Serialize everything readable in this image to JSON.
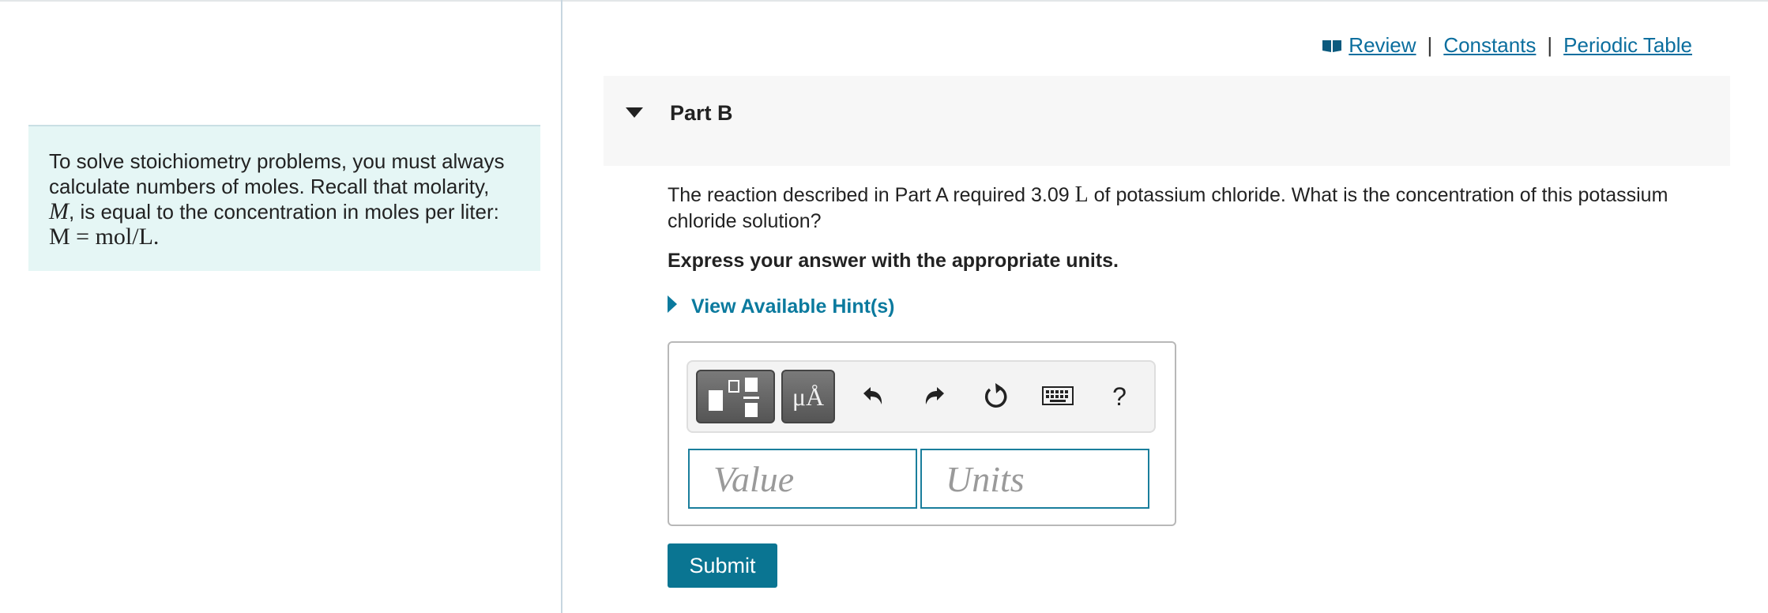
{
  "links": {
    "review": "Review",
    "constants": "Constants",
    "periodic_table": "Periodic Table",
    "separator": "|"
  },
  "info": {
    "line1": "To solve stoichiometry problems, you must always calculate numbers of moles. Recall that molarity,",
    "molarity_symbol": "M",
    "line2": ", is equal to the concentration in moles per liter:",
    "equation": "M = mol/L."
  },
  "part": {
    "title": "Part B"
  },
  "question": {
    "text_before": "The reaction described in Part A required 3.09 ",
    "unit": "L",
    "text_after": " of potassium chloride. What is the concentration of this potassium chloride solution?",
    "instruction": "Express your answer with the appropriate units."
  },
  "hint": {
    "label": "View Available Hint(s)"
  },
  "toolbar": {
    "units_symbol": "μÅ",
    "help": "?",
    "icons": [
      "templates-icon",
      "units-icon",
      "undo-icon",
      "redo-icon",
      "reset-icon",
      "keyboard-icon",
      "help-icon"
    ]
  },
  "answer": {
    "value": "",
    "value_placeholder": "Value",
    "units": "",
    "units_placeholder": "Units"
  },
  "submit": {
    "label": "Submit"
  },
  "colors": {
    "accent": "#0a7592",
    "link": "#0b6e9e",
    "info_bg": "#e5f6f5"
  }
}
